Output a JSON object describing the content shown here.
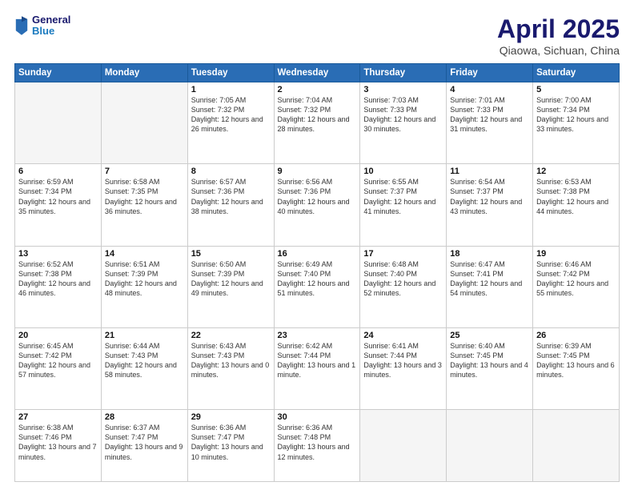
{
  "logo": {
    "line1": "General",
    "line2": "Blue"
  },
  "title": {
    "month": "April 2025",
    "location": "Qiaowa, Sichuan, China"
  },
  "weekdays": [
    "Sunday",
    "Monday",
    "Tuesday",
    "Wednesday",
    "Thursday",
    "Friday",
    "Saturday"
  ],
  "weeks": [
    [
      {
        "day": "",
        "info": ""
      },
      {
        "day": "",
        "info": ""
      },
      {
        "day": "1",
        "info": "Sunrise: 7:05 AM\nSunset: 7:32 PM\nDaylight: 12 hours and 26 minutes."
      },
      {
        "day": "2",
        "info": "Sunrise: 7:04 AM\nSunset: 7:32 PM\nDaylight: 12 hours and 28 minutes."
      },
      {
        "day": "3",
        "info": "Sunrise: 7:03 AM\nSunset: 7:33 PM\nDaylight: 12 hours and 30 minutes."
      },
      {
        "day": "4",
        "info": "Sunrise: 7:01 AM\nSunset: 7:33 PM\nDaylight: 12 hours and 31 minutes."
      },
      {
        "day": "5",
        "info": "Sunrise: 7:00 AM\nSunset: 7:34 PM\nDaylight: 12 hours and 33 minutes."
      }
    ],
    [
      {
        "day": "6",
        "info": "Sunrise: 6:59 AM\nSunset: 7:34 PM\nDaylight: 12 hours and 35 minutes."
      },
      {
        "day": "7",
        "info": "Sunrise: 6:58 AM\nSunset: 7:35 PM\nDaylight: 12 hours and 36 minutes."
      },
      {
        "day": "8",
        "info": "Sunrise: 6:57 AM\nSunset: 7:36 PM\nDaylight: 12 hours and 38 minutes."
      },
      {
        "day": "9",
        "info": "Sunrise: 6:56 AM\nSunset: 7:36 PM\nDaylight: 12 hours and 40 minutes."
      },
      {
        "day": "10",
        "info": "Sunrise: 6:55 AM\nSunset: 7:37 PM\nDaylight: 12 hours and 41 minutes."
      },
      {
        "day": "11",
        "info": "Sunrise: 6:54 AM\nSunset: 7:37 PM\nDaylight: 12 hours and 43 minutes."
      },
      {
        "day": "12",
        "info": "Sunrise: 6:53 AM\nSunset: 7:38 PM\nDaylight: 12 hours and 44 minutes."
      }
    ],
    [
      {
        "day": "13",
        "info": "Sunrise: 6:52 AM\nSunset: 7:38 PM\nDaylight: 12 hours and 46 minutes."
      },
      {
        "day": "14",
        "info": "Sunrise: 6:51 AM\nSunset: 7:39 PM\nDaylight: 12 hours and 48 minutes."
      },
      {
        "day": "15",
        "info": "Sunrise: 6:50 AM\nSunset: 7:39 PM\nDaylight: 12 hours and 49 minutes."
      },
      {
        "day": "16",
        "info": "Sunrise: 6:49 AM\nSunset: 7:40 PM\nDaylight: 12 hours and 51 minutes."
      },
      {
        "day": "17",
        "info": "Sunrise: 6:48 AM\nSunset: 7:40 PM\nDaylight: 12 hours and 52 minutes."
      },
      {
        "day": "18",
        "info": "Sunrise: 6:47 AM\nSunset: 7:41 PM\nDaylight: 12 hours and 54 minutes."
      },
      {
        "day": "19",
        "info": "Sunrise: 6:46 AM\nSunset: 7:42 PM\nDaylight: 12 hours and 55 minutes."
      }
    ],
    [
      {
        "day": "20",
        "info": "Sunrise: 6:45 AM\nSunset: 7:42 PM\nDaylight: 12 hours and 57 minutes."
      },
      {
        "day": "21",
        "info": "Sunrise: 6:44 AM\nSunset: 7:43 PM\nDaylight: 12 hours and 58 minutes."
      },
      {
        "day": "22",
        "info": "Sunrise: 6:43 AM\nSunset: 7:43 PM\nDaylight: 13 hours and 0 minutes."
      },
      {
        "day": "23",
        "info": "Sunrise: 6:42 AM\nSunset: 7:44 PM\nDaylight: 13 hours and 1 minute."
      },
      {
        "day": "24",
        "info": "Sunrise: 6:41 AM\nSunset: 7:44 PM\nDaylight: 13 hours and 3 minutes."
      },
      {
        "day": "25",
        "info": "Sunrise: 6:40 AM\nSunset: 7:45 PM\nDaylight: 13 hours and 4 minutes."
      },
      {
        "day": "26",
        "info": "Sunrise: 6:39 AM\nSunset: 7:45 PM\nDaylight: 13 hours and 6 minutes."
      }
    ],
    [
      {
        "day": "27",
        "info": "Sunrise: 6:38 AM\nSunset: 7:46 PM\nDaylight: 13 hours and 7 minutes."
      },
      {
        "day": "28",
        "info": "Sunrise: 6:37 AM\nSunset: 7:47 PM\nDaylight: 13 hours and 9 minutes."
      },
      {
        "day": "29",
        "info": "Sunrise: 6:36 AM\nSunset: 7:47 PM\nDaylight: 13 hours and 10 minutes."
      },
      {
        "day": "30",
        "info": "Sunrise: 6:36 AM\nSunset: 7:48 PM\nDaylight: 13 hours and 12 minutes."
      },
      {
        "day": "",
        "info": ""
      },
      {
        "day": "",
        "info": ""
      },
      {
        "day": "",
        "info": ""
      }
    ]
  ]
}
